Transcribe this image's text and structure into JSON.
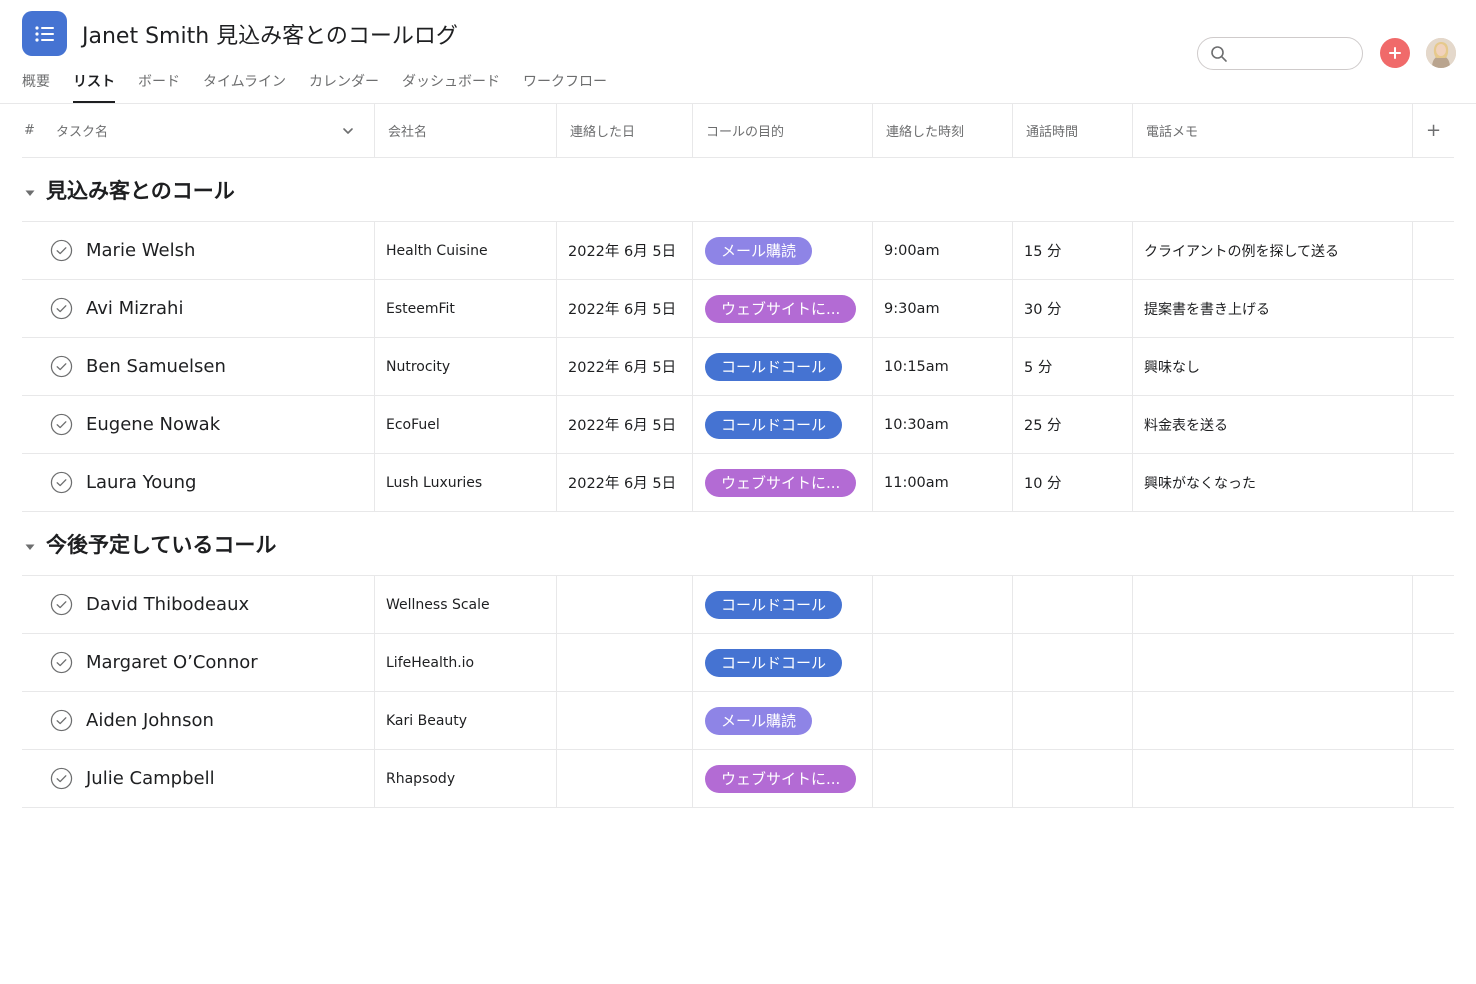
{
  "app": {
    "title": "Janet Smith 見込み客とのコールログ"
  },
  "tabs": [
    {
      "label": "概要",
      "active": false
    },
    {
      "label": "リスト",
      "active": true
    },
    {
      "label": "ボード",
      "active": false
    },
    {
      "label": "タイムライン",
      "active": false
    },
    {
      "label": "カレンダー",
      "active": false
    },
    {
      "label": "ダッシュボード",
      "active": false
    },
    {
      "label": "ワークフロー",
      "active": false
    }
  ],
  "search": {
    "value": "",
    "placeholder": ""
  },
  "columns": {
    "hash": "#",
    "task": "タスク名",
    "company": "会社名",
    "date": "連絡した日",
    "purpose": "コールの目的",
    "time": "連絡した時刻",
    "duration": "通話時間",
    "memo": "電話メモ",
    "add": "+"
  },
  "tag_colors": {
    "メール購読": "#8e84e6",
    "ウェブサイトに...": "#b36bd4",
    "コールドコール": "#4573d2"
  },
  "accent": {
    "app_icon": "#4573d2",
    "add_button": "#f06a6a"
  },
  "sections": [
    {
      "title": "見込み客とのコール",
      "rows": [
        {
          "name": "Marie Welsh",
          "company": "Health Cuisine",
          "date": "2022年 6月 5日",
          "purpose": "メール購読",
          "time": "9:00am",
          "duration": "15 分",
          "memo": "クライアントの例を探して送る"
        },
        {
          "name": "Avi Mizrahi",
          "company": "EsteemFit",
          "date": "2022年 6月 5日",
          "purpose": "ウェブサイトに...",
          "time": "9:30am",
          "duration": "30 分",
          "memo": "提案書を書き上げる"
        },
        {
          "name": "Ben Samuelsen",
          "company": "Nutrocity",
          "date": "2022年 6月 5日",
          "purpose": "コールドコール",
          "time": "10:15am",
          "duration": "5 分",
          "memo": "興味なし"
        },
        {
          "name": "Eugene Nowak",
          "company": "EcoFuel",
          "date": "2022年 6月 5日",
          "purpose": "コールドコール",
          "time": "10:30am",
          "duration": "25 分",
          "memo": "料金表を送る"
        },
        {
          "name": "Laura Young",
          "company": "Lush Luxuries",
          "date": "2022年 6月 5日",
          "purpose": "ウェブサイトに...",
          "time": "11:00am",
          "duration": "10 分",
          "memo": "興味がなくなった"
        }
      ]
    },
    {
      "title": "今後予定しているコール",
      "rows": [
        {
          "name": "David Thibodeaux",
          "company": "Wellness Scale",
          "date": "",
          "purpose": "コールドコール",
          "time": "",
          "duration": "",
          "memo": ""
        },
        {
          "name": "Margaret O’Connor",
          "company": "LifeHealth.io",
          "date": "",
          "purpose": "コールドコール",
          "time": "",
          "duration": "",
          "memo": ""
        },
        {
          "name": "Aiden Johnson",
          "company": "Kari Beauty",
          "date": "",
          "purpose": "メール購読",
          "time": "",
          "duration": "",
          "memo": ""
        },
        {
          "name": "Julie Campbell",
          "company": "Rhapsody",
          "date": "",
          "purpose": "ウェブサイトに...",
          "time": "",
          "duration": "",
          "memo": ""
        }
      ]
    }
  ]
}
